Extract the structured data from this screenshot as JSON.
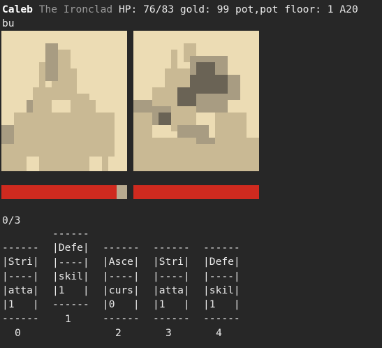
{
  "player": {
    "name": "Caleb",
    "class_name": "The Ironclad",
    "hp_label": "HP:",
    "hp": "76/83",
    "gold_label": "gold:",
    "gold": "99",
    "potions": "pot,pot",
    "floor_label": "floor:",
    "floor": "1",
    "ascension": "A20",
    "extra": "bu"
  },
  "combat": {
    "player_hp_fraction": 0.916,
    "enemy_hp_fraction": 1.0,
    "energy": "0/3"
  },
  "colors": {
    "portrait_light": "#ecdcb4",
    "portrait_mid": "#c9b994",
    "portrait_dark": "#a89c82",
    "portrait_shadow": "#6a6355",
    "hp_bar": "#cf2a1f",
    "hp_missing": "#b8ab90",
    "background": "#272727"
  },
  "hand": [
    {
      "index": "0",
      "lines": [
        "------",
        "|Stri|",
        "|----|",
        "|atta|",
        "|1   |",
        "------"
      ]
    },
    {
      "index": "1",
      "lines": [
        "------",
        "|Defe|",
        "|----|",
        "|skil|",
        "|1   |",
        "------"
      ]
    },
    {
      "index": "2",
      "lines": [
        "------",
        "|Asce|",
        "|----|",
        "|curs|",
        "|0   |",
        "------"
      ]
    },
    {
      "index": "3",
      "lines": [
        "------",
        "|Stri|",
        "|----|",
        "|atta|",
        "|1   |",
        "------"
      ]
    },
    {
      "index": "4",
      "lines": [
        "------",
        "|Defe|",
        "|----|",
        "|skil|",
        "|1   |",
        "------"
      ]
    }
  ]
}
